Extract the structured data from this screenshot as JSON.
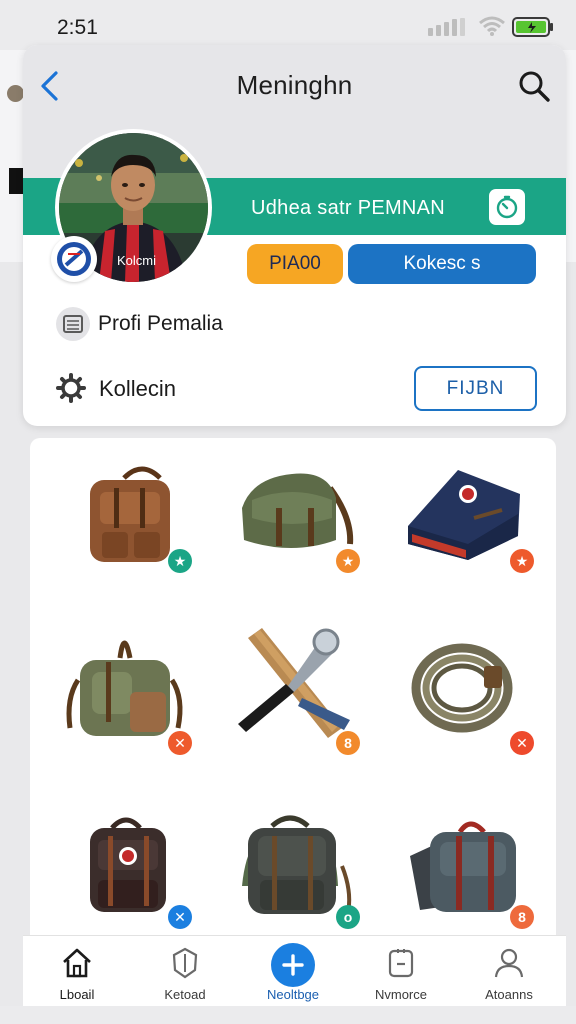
{
  "status_bar": {
    "time": "2:51"
  },
  "header": {
    "title": "Meninghn"
  },
  "profile_band": {
    "name": "Udhea satr PEMNAN"
  },
  "pills": {
    "primary": "PIA00",
    "secondary": "Kokesc s"
  },
  "profile_link": {
    "label": "Profi Pemalia"
  },
  "collection_row": {
    "label": "Kollecin",
    "action_label": "FIJBN"
  },
  "items": [
    {
      "name": "brown-backpack",
      "badge_symbol": "★",
      "badge_color": "#1ba586"
    },
    {
      "name": "green-messenger-bag",
      "badge_symbol": "★",
      "badge_color": "#f28a2c"
    },
    {
      "name": "navy-folded-bag",
      "badge_symbol": "★",
      "badge_color": "#ee5a2c"
    },
    {
      "name": "olive-rucksack",
      "badge_symbol": "✕",
      "badge_color": "#ee5a2c"
    },
    {
      "name": "tool-set",
      "badge_symbol": "8",
      "badge_color": "#f28a2c"
    },
    {
      "name": "coiled-rope",
      "badge_symbol": "✕",
      "badge_color": "#ee4a2c"
    },
    {
      "name": "dark-backpack",
      "badge_symbol": "✕",
      "badge_color": "#1b7fe0"
    },
    {
      "name": "grey-green-backpack",
      "badge_symbol": "o",
      "badge_color": "#1ba586"
    },
    {
      "name": "slate-duffel-bag",
      "badge_symbol": "8",
      "badge_color": "#ee6a3c"
    }
  ],
  "bottom_nav": [
    {
      "label": "Lboail",
      "icon": "home-icon"
    },
    {
      "label": "Ketoad",
      "icon": "shield-icon"
    },
    {
      "label": "Neoltbge",
      "icon": "plus-icon"
    },
    {
      "label": "Nvmorce",
      "icon": "tablet-icon"
    },
    {
      "label": "Atoanns",
      "icon": "person-icon"
    }
  ],
  "colors": {
    "accent_green": "#1ba586",
    "accent_blue": "#1c73c4",
    "accent_orange": "#f6a623"
  }
}
